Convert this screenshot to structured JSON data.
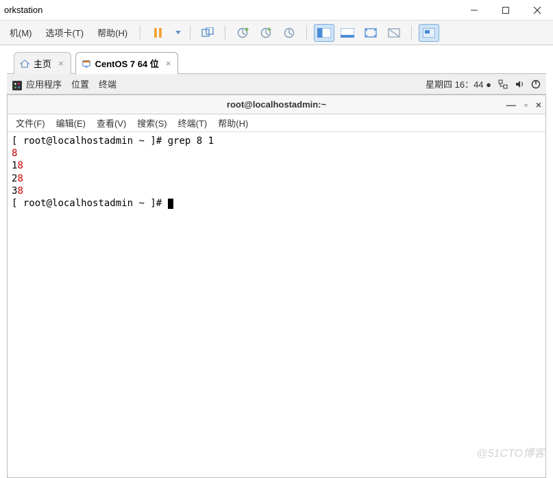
{
  "outer": {
    "title_fragment": "orkstation"
  },
  "vm_menu": {
    "item_machine": "机(M)",
    "item_tabs": "选项卡(T)",
    "item_help": "帮助(H)"
  },
  "tabs": {
    "home_label": "主页",
    "centos_label": "CentOS 7 64 位"
  },
  "guest_panel": {
    "apps": "应用程序",
    "places": "位置",
    "terminal": "终端",
    "clock": "星期四 16：44 ●"
  },
  "terminal": {
    "title": "root@localhostadmin:~",
    "menu": {
      "file": "文件(F)",
      "edit": "编辑(E)",
      "view": "查看(V)",
      "search": "搜索(S)",
      "terminal": "终端(T)",
      "help": "帮助(H)"
    },
    "lines": {
      "prompt1_open": "[",
      "prompt1_userhost": "root@localhostadmin ~",
      "prompt1_close": "]#",
      "cmd1": " grep 8 1",
      "l1_red": "8",
      "l2_plain": "1",
      "l2_red": "8",
      "l3_plain": "2",
      "l3_red": "8",
      "l4_plain": "3",
      "l4_red": "8",
      "prompt2_open": "[",
      "prompt2_userhost": "root@localhostadmin ~",
      "prompt2_close": "]# "
    }
  },
  "watermark": "@51CTO博客"
}
